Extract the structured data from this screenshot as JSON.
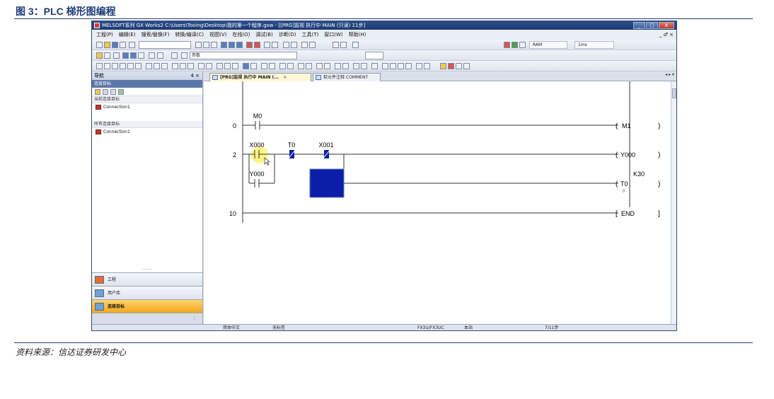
{
  "figure": {
    "caption": "图 3：PLC 梯形图编程",
    "source": "资料来源：信达证券研发中心"
  },
  "window": {
    "title": "MELSOFT系列 GX Works2 C:\\Users\\Tooing\\Desktop\\我的第一个程序.gxw - [[PRG]监视 执行中 MAIN (只读) 11步]",
    "controls": [
      "_",
      "□",
      "X"
    ]
  },
  "menu": {
    "items": [
      "工程(P)",
      "编辑(E)",
      "搜索/替换(F)",
      "转换/编译(C)",
      "视图(V)",
      "在线(O)",
      "调试(B)",
      "诊断(D)",
      "工具(T)",
      "窗口(W)",
      "帮助(H)"
    ],
    "mdi_controls": "_ ♂ ×"
  },
  "toolbar": {
    "param_combo": "参数",
    "ram_label": "RAM",
    "scan_time": "1ms"
  },
  "navigation": {
    "title": "导航",
    "pin": "4 ×",
    "subheader": "连接目标",
    "current_group": "当前连接目标",
    "current_item": "Connection1",
    "all_group": "所有连接目标",
    "all_item": "Connection1",
    "tabs": [
      {
        "label": "工程",
        "active": false
      },
      {
        "label": "用户库",
        "active": false
      },
      {
        "label": "连接目标",
        "active": true
      }
    ]
  },
  "editor": {
    "tabs": [
      {
        "label": "[PRG]监视 执行中 MAIN (...",
        "close": "×",
        "active": true
      },
      {
        "label": "软元件注释 COMMENT",
        "active": false
      }
    ],
    "tab_arrows": "◂ ▸ ▾"
  },
  "ladder": {
    "rungs": [
      {
        "step": "0",
        "contacts": [
          {
            "label": "M0",
            "type": "NO"
          }
        ],
        "coil": "M1"
      },
      {
        "step": "2",
        "contacts": [
          {
            "label": "X000",
            "type": "NO"
          },
          {
            "label": "T0",
            "type": "NC"
          },
          {
            "label": "X001",
            "type": "NC"
          }
        ],
        "branch": {
          "label": "Y000",
          "type": "NO"
        },
        "coils": [
          {
            "label": "Y000"
          },
          {
            "label": "T0",
            "setting": "K30",
            "current": "0"
          }
        ]
      },
      {
        "step": "10",
        "instruction": "END"
      }
    ],
    "highlight_color": "#fff27a",
    "energized_color": "#0a1ea8"
  },
  "status": {
    "language": "简体中文",
    "title": "无标签",
    "plc": "FX3U/FX3UC",
    "station": "本站",
    "steps": "7/11步"
  }
}
